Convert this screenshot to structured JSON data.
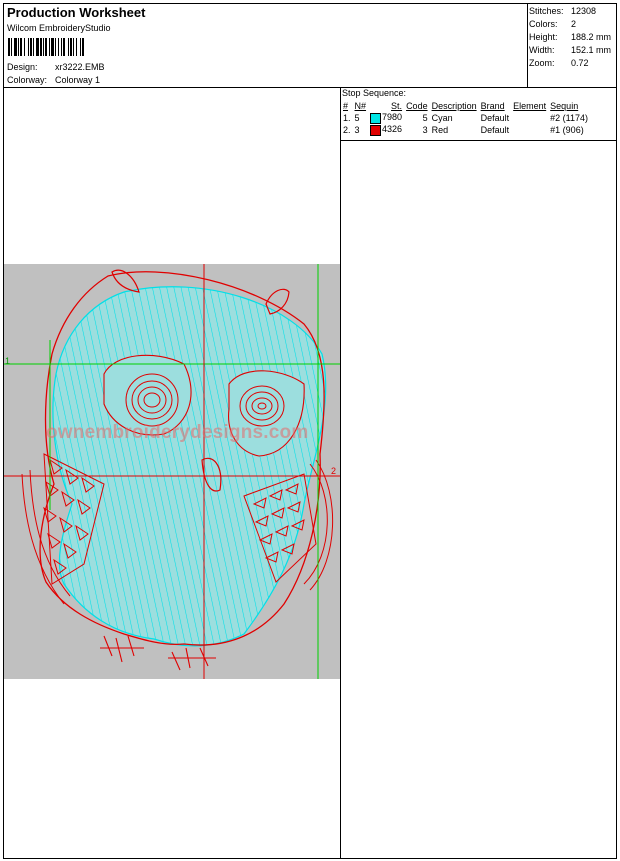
{
  "header": {
    "title": "Production Worksheet",
    "software": "Wilcom  EmbroideryStudio",
    "design_label": "Design:",
    "design_value": "xr3222.EMB",
    "colorway_label": "Colorway:",
    "colorway_value": "Colorway 1"
  },
  "stats": {
    "stitches_label": "Stitches:",
    "stitches_value": "12308",
    "colors_label": "Colors:",
    "colors_value": "2",
    "height_label": "Height:",
    "height_value": "188.2 mm",
    "width_label": "Width:",
    "width_value": "152.1 mm",
    "zoom_label": "Zoom:",
    "zoom_value": "0.72"
  },
  "stop_sequence": {
    "title": "Stop Sequence:",
    "columns": [
      "#",
      "N#",
      "St.",
      "Code",
      "Description",
      "Brand",
      "Element",
      "Sequin"
    ],
    "rows": [
      {
        "num": "1.",
        "n": "5",
        "color": "#00e5e5",
        "st": "7980",
        "code": "5",
        "desc": "Cyan",
        "brand": "Default",
        "element": "",
        "sequin": "#2 (1174)"
      },
      {
        "num": "2.",
        "n": "3",
        "color": "#e00000",
        "st": "4326",
        "code": "3",
        "desc": "Red",
        "brand": "Default",
        "element": "",
        "sequin": "#1 (906)"
      }
    ]
  },
  "preview": {
    "watermark": "ownembroiderydesigns.com",
    "marker_1": "1",
    "marker_2": "2"
  }
}
